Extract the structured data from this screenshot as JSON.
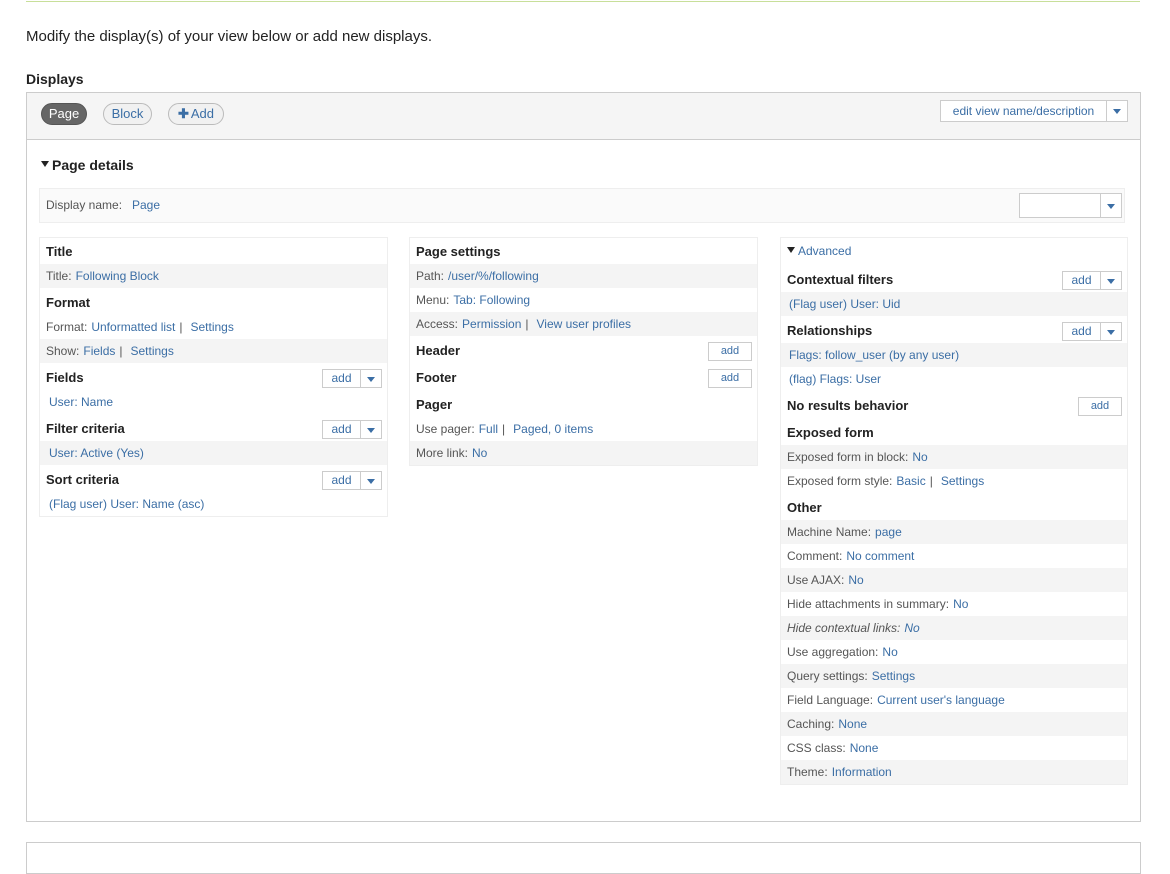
{
  "intro_text": "Modify the display(s) of your view below or add new displays.",
  "displays_heading": "Displays",
  "tabs": {
    "page": "Page",
    "block": "Block",
    "add": "Add"
  },
  "edit_view_label": "edit view name/description",
  "page_details_title": "Page details",
  "display_name": {
    "label": "Display name:",
    "value": "Page"
  },
  "add_label": "add",
  "col1": {
    "title_h": "Title",
    "title": {
      "label": "Title:",
      "value": "Following Block"
    },
    "format_h": "Format",
    "format": {
      "label": "Format:",
      "value": "Unformatted list",
      "settings": "Settings"
    },
    "show": {
      "label": "Show:",
      "value": "Fields",
      "settings": "Settings"
    },
    "fields_h": "Fields",
    "field_item": "User: Name",
    "filter_h": "Filter criteria",
    "filter_item": "User: Active (Yes)",
    "sort_h": "Sort criteria",
    "sort_item": "(Flag user) User: Name (asc)"
  },
  "col2": {
    "page_settings_h": "Page settings",
    "path": {
      "label": "Path:",
      "value": "/user/%/following"
    },
    "menu": {
      "label": "Menu:",
      "value": "Tab: Following"
    },
    "access": {
      "label": "Access:",
      "value": "Permission",
      "value2": "View user profiles"
    },
    "header_h": "Header",
    "footer_h": "Footer",
    "pager_h": "Pager",
    "use_pager": {
      "label": "Use pager:",
      "value": "Full",
      "value2": "Paged, 0 items"
    },
    "more_link": {
      "label": "More link:",
      "value": "No"
    }
  },
  "col3": {
    "advanced": "Advanced",
    "contextual_h": "Contextual filters",
    "contextual_item": "(Flag user) User: Uid",
    "relationships_h": "Relationships",
    "rel_item1": "Flags: follow_user (by any user)",
    "rel_item2": "(flag) Flags: User",
    "no_results_h": "No results behavior",
    "exposed_h": "Exposed form",
    "exposed_block": {
      "label": "Exposed form in block:",
      "value": "No"
    },
    "exposed_style": {
      "label": "Exposed form style:",
      "value": "Basic",
      "settings": "Settings"
    },
    "other_h": "Other",
    "other": [
      {
        "label": "Machine Name:",
        "value": "page",
        "italic": false
      },
      {
        "label": "Comment:",
        "value": "No comment",
        "italic": false
      },
      {
        "label": "Use AJAX:",
        "value": "No",
        "italic": false
      },
      {
        "label": "Hide attachments in summary:",
        "value": "No",
        "italic": false
      },
      {
        "label": "Hide contextual links:",
        "value": "No",
        "italic": true
      },
      {
        "label": "Use aggregation:",
        "value": "No",
        "italic": false
      },
      {
        "label": "Query settings:",
        "value": "Settings",
        "italic": false
      },
      {
        "label": "Field Language:",
        "value": "Current user's language",
        "italic": false
      },
      {
        "label": "Caching:",
        "value": "None",
        "italic": false
      },
      {
        "label": "CSS class:",
        "value": "None",
        "italic": false
      },
      {
        "label": "Theme:",
        "value": "Information",
        "italic": false
      }
    ]
  },
  "colors": {
    "link": "#3b6ea5",
    "active_tab": "#666666",
    "status_line": "#c8df9a"
  }
}
